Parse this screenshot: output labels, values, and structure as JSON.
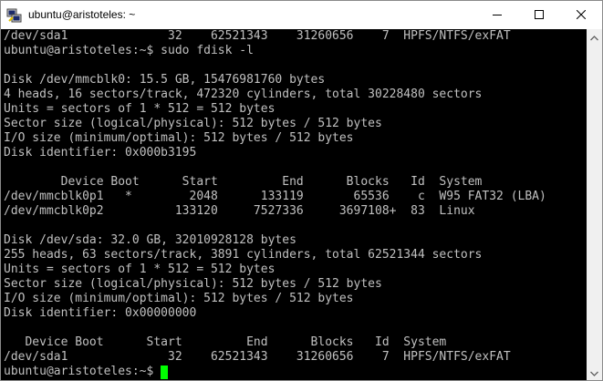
{
  "window": {
    "title": "ubuntu@aristoteles: ~"
  },
  "terminal": {
    "lines": [
      "/dev/sda1              32    62521343    31260656    7  HPFS/NTFS/exFAT",
      "ubuntu@aristoteles:~$ sudo fdisk -l",
      "",
      "Disk /dev/mmcblk0: 15.5 GB, 15476981760 bytes",
      "4 heads, 16 sectors/track, 472320 cylinders, total 30228480 sectors",
      "Units = sectors of 1 * 512 = 512 bytes",
      "Sector size (logical/physical): 512 bytes / 512 bytes",
      "I/O size (minimum/optimal): 512 bytes / 512 bytes",
      "Disk identifier: 0x000b3195",
      "",
      "        Device Boot      Start         End      Blocks   Id  System",
      "/dev/mmcblk0p1   *        2048      133119       65536    c  W95 FAT32 (LBA)",
      "/dev/mmcblk0p2          133120     7527336     3697108+  83  Linux",
      "",
      "Disk /dev/sda: 32.0 GB, 32010928128 bytes",
      "255 heads, 63 sectors/track, 3891 cylinders, total 62521344 sectors",
      "Units = sectors of 1 * 512 = 512 bytes",
      "Sector size (logical/physical): 512 bytes / 512 bytes",
      "I/O size (minimum/optimal): 512 bytes / 512 bytes",
      "Disk identifier: 0x00000000",
      "",
      "   Device Boot      Start         End      Blocks   Id  System",
      "/dev/sda1              32    62521343    31260656    7  HPFS/NTFS/exFAT"
    ],
    "prompt": "ubuntu@aristoteles:~$ "
  },
  "colors": {
    "background": "#000000",
    "text": "#c0c0c0",
    "cursor": "#00ff00"
  },
  "icons": {
    "app": "putty-icon",
    "minimize": "minimize-icon",
    "maximize": "maximize-icon",
    "close": "close-icon",
    "scroll_up": "scroll-up-arrow-icon",
    "scroll_down": "scroll-down-arrow-icon"
  }
}
